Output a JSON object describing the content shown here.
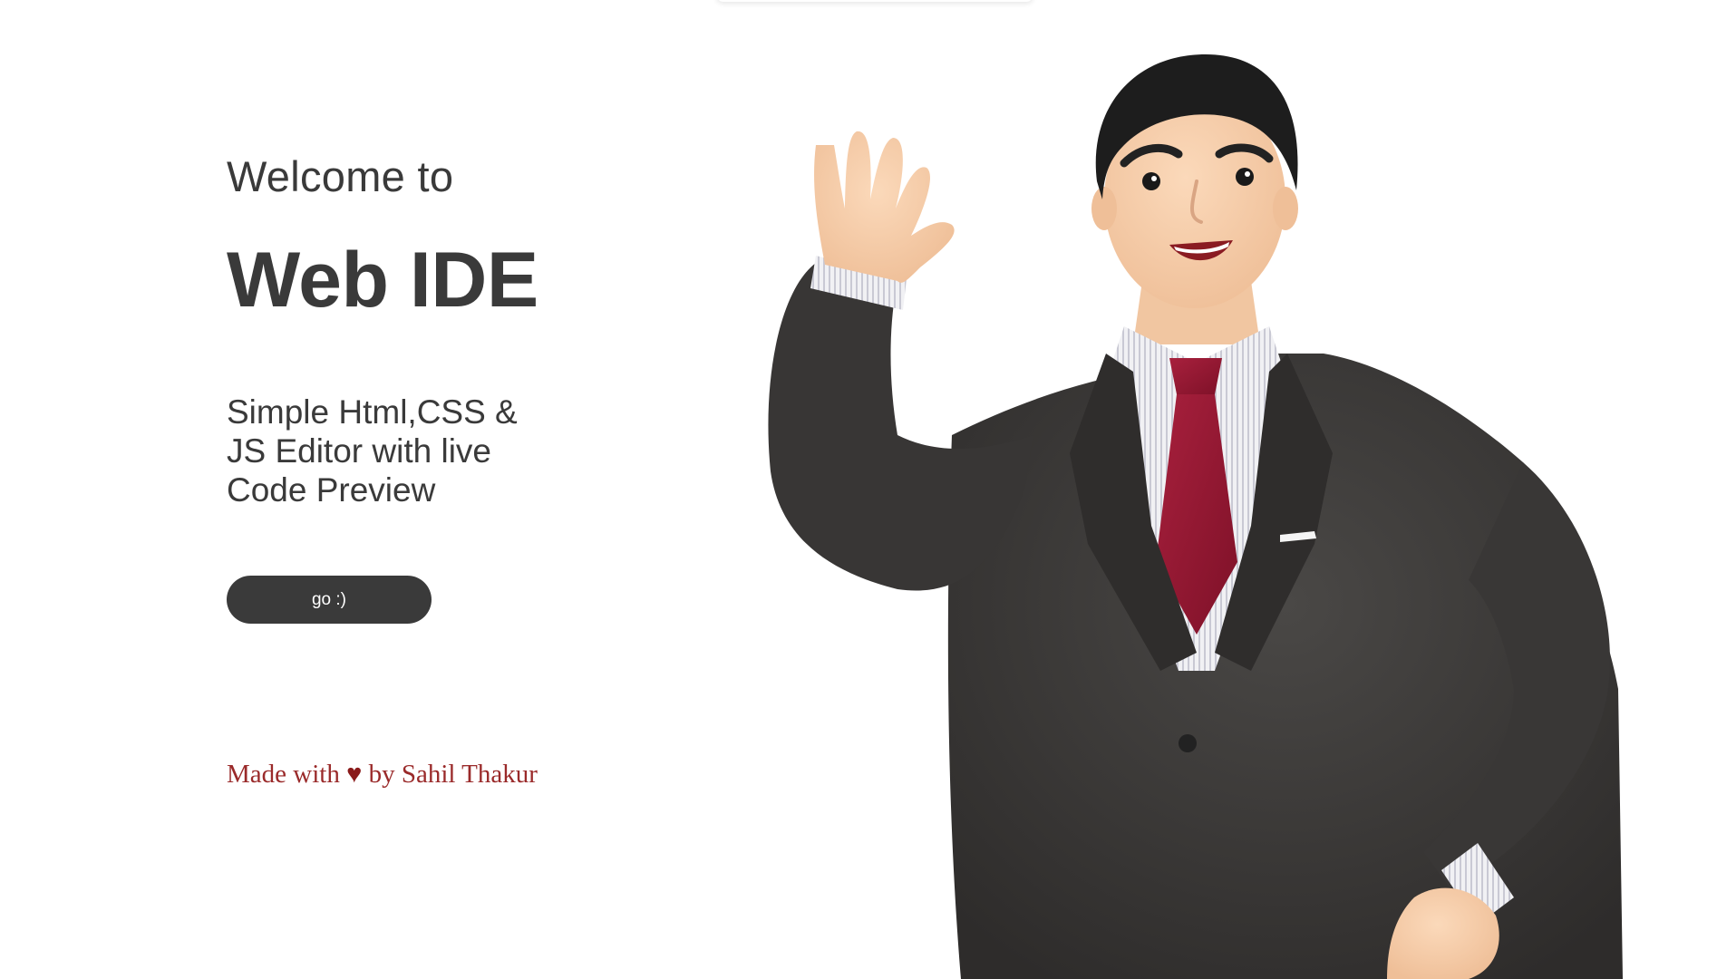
{
  "hero": {
    "welcome": "Welcome to",
    "title": "Web IDE",
    "tagline": "Simple Html,CSS & JS Editor with live Code Preview",
    "cta_label": "go :)"
  },
  "footer": {
    "prefix": "Made with",
    "heart": "♥",
    "suffix": "by Sahil Thakur"
  },
  "illustration": {
    "icon": "waving-businessman-illustration"
  },
  "colors": {
    "text": "#3a3a3a",
    "button_bg": "#3a3a3a",
    "button_text": "#ffffff",
    "credit": "#9a2a2a",
    "suit": "#3d3b3a",
    "tie": "#9b1b35",
    "skin": "#f6cda9",
    "hair": "#1d1d1d"
  }
}
